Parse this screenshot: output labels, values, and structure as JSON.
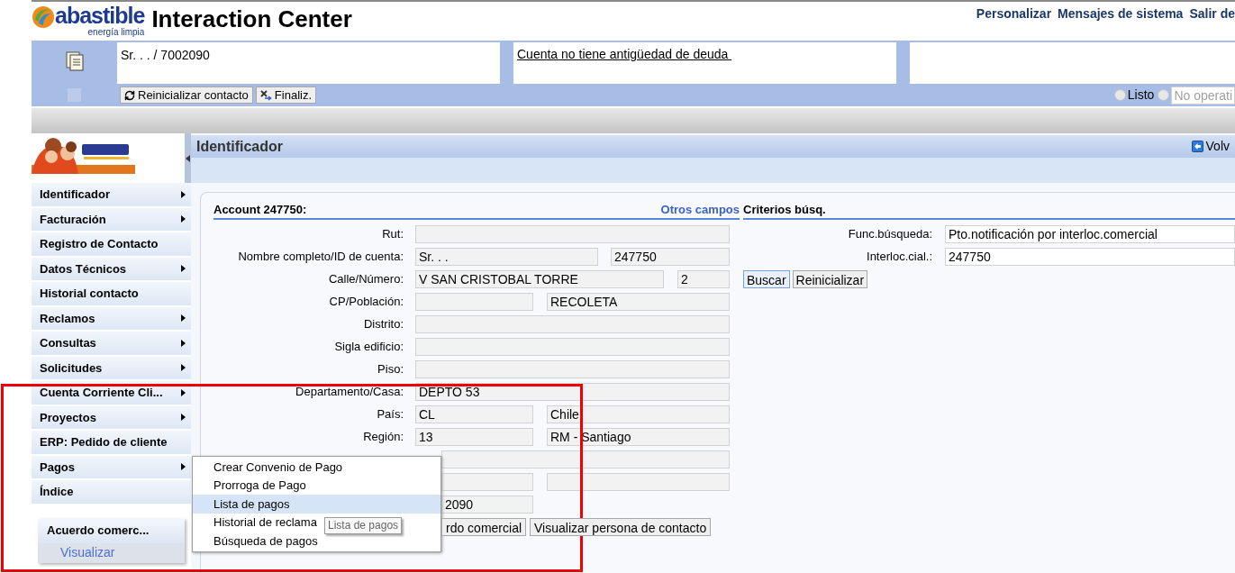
{
  "header": {
    "brand": "abastible",
    "tagline": "energía limpia",
    "title": "Interaction Center",
    "links": [
      "Personalizar",
      "Mensajes de sistema",
      "Salir de"
    ]
  },
  "context_bar": {
    "customer": "Sr. . . / 7002090",
    "alert": "Cuenta no tiene antigüedad de deuda ",
    "buttons": [
      {
        "label": "Reinicializar contacto",
        "kind": "reset"
      },
      {
        "label": "Finaliz.",
        "kind": "end"
      }
    ],
    "status": [
      {
        "label": "Listo",
        "kind": "label",
        "selected": false
      },
      {
        "label": "No operati",
        "kind": "field",
        "selected": false
      }
    ]
  },
  "sidebar": {
    "items": [
      {
        "label": "Identificador",
        "has_submenu": true
      },
      {
        "label": "Facturación",
        "has_submenu": true
      },
      {
        "label": "Registro de Contacto",
        "has_submenu": false
      },
      {
        "label": "Datos Técnicos",
        "has_submenu": true
      },
      {
        "label": "Historial contacto",
        "has_submenu": false
      },
      {
        "label": "Reclamos",
        "has_submenu": true
      },
      {
        "label": "Consultas",
        "has_submenu": true
      },
      {
        "label": "Solicitudes",
        "has_submenu": true
      },
      {
        "label": "Cuenta Corriente Cli...",
        "has_submenu": true
      },
      {
        "label": "Proyectos",
        "has_submenu": true
      },
      {
        "label": "ERP: Pedido de cliente",
        "has_submenu": false
      },
      {
        "label": "Pagos",
        "has_submenu": true
      },
      {
        "label": "Índice",
        "has_submenu": false
      }
    ],
    "panel": {
      "title": "Acuerdo comerc...",
      "link": "Visualizar"
    }
  },
  "page": {
    "title": "Identificador",
    "back_link": "Volv"
  },
  "account": {
    "title": "Account 247750:",
    "link": "Otros campos",
    "rows": [
      {
        "label": "Rut:",
        "kind": "single"
      },
      {
        "label": "Nombre completo/ID de cuenta:",
        "kind": "name_id",
        "value_1": "Sr. . .",
        "value_2": "247750"
      },
      {
        "label": "Calle/Número:",
        "kind": "street",
        "value_1": "V SAN CRISTOBAL TORRE",
        "value_2": "2"
      },
      {
        "label": "CP/Población:",
        "kind": "pair",
        "value_2": "RECOLETA"
      },
      {
        "label": "Distrito:",
        "kind": "single"
      },
      {
        "label": "Sigla edificio:",
        "kind": "single"
      },
      {
        "label": "Piso:",
        "kind": "single"
      },
      {
        "label": "Departamento/Casa:",
        "kind": "single",
        "value_1": "DEPTO 53"
      },
      {
        "label": "País:",
        "kind": "pair",
        "value_1": "CL",
        "value_2": "Chile"
      },
      {
        "label": "Región:",
        "kind": "pair",
        "value_1": "13",
        "value_2": "RM - Santiago"
      },
      {
        "kind": "single"
      },
      {
        "kind": "pair"
      },
      {
        "kind": "first_only",
        "value_1": "2090"
      }
    ],
    "buttons": [
      "rdo comercial",
      "Visualizar persona de contacto"
    ]
  },
  "search": {
    "title": "Criterios búsq.",
    "rows": [
      {
        "label": "Func.búsqueda:",
        "value": "Pto.notificación por interloc.comercial"
      },
      {
        "label": "Interloc.cial.:",
        "value": "247750"
      }
    ],
    "buttons": [
      {
        "label": "Buscar",
        "primary": true
      },
      {
        "label": "Reinicializar",
        "primary": false
      }
    ]
  },
  "popup_menu": {
    "items": [
      {
        "label": "Crear Convenio de Pago",
        "selected": false
      },
      {
        "label": "Prorroga de Pago",
        "selected": false
      },
      {
        "label": "Lista de pagos",
        "selected": true
      },
      {
        "label": "Historial de reclama",
        "selected": false
      },
      {
        "label": "Búsqueda de pagos",
        "selected": false
      }
    ],
    "tooltip": "Lista de pagos"
  }
}
